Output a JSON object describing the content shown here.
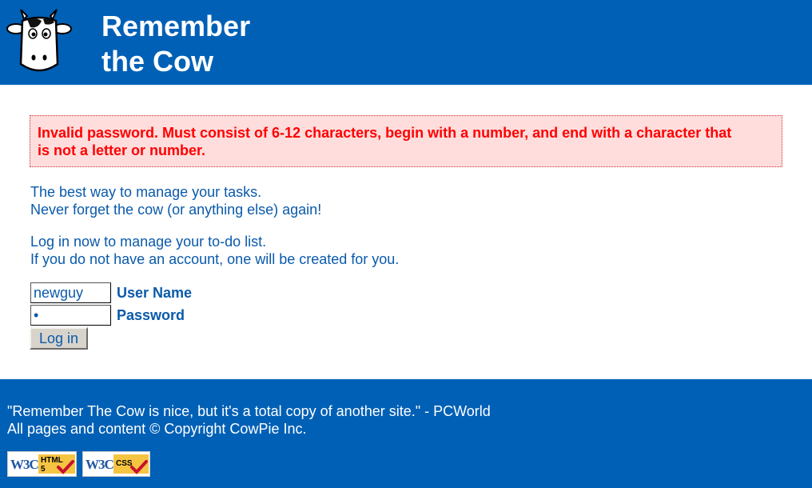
{
  "header": {
    "title_line1": "Remember",
    "title_line2": "the Cow"
  },
  "error": {
    "message_line1": "Invalid password. Must consist of 6-12 characters, begin with a number, and end with a character that",
    "message_line2": "is not a letter or number."
  },
  "intro": {
    "line1": "The best way to manage your tasks.",
    "line2": "Never forget the cow (or anything else) again!",
    "line3": "Log in now to manage your to-do list.",
    "line4": "If you do not have an account, one will be created for you."
  },
  "form": {
    "username_value": "newguy",
    "username_label": "User Name",
    "password_value": "•",
    "password_label": "Password",
    "login_label": "Log in"
  },
  "footer": {
    "quote": "\"Remember The Cow is nice, but it's a total copy of another site.\" - PCWorld",
    "copyright": "All pages and content © Copyright CowPie Inc.",
    "badges": [
      {
        "org": "W3C",
        "tag_line1": "HTML",
        "tag_line2": "5"
      },
      {
        "org": "W3C",
        "tag_line1": "CSS",
        "tag_line2": ""
      }
    ]
  },
  "colors": {
    "brand_blue": "#0060b6",
    "text_blue": "#0a5aaa",
    "error_red": "#ff0000",
    "error_bg": "#ffdddd"
  },
  "icons": [
    "cow-logo-icon",
    "checkmark-icon"
  ]
}
